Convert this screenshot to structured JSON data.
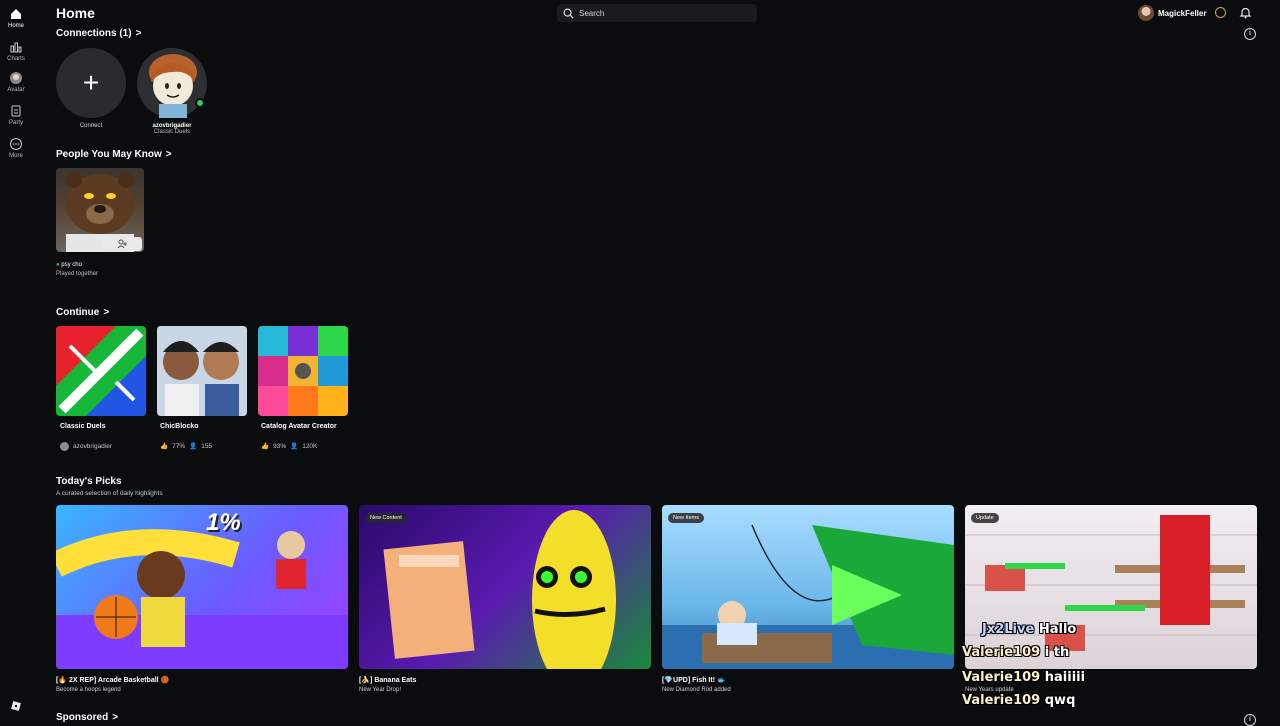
{
  "sidebar": {
    "items": [
      {
        "label": "Home",
        "icon": "home-icon"
      },
      {
        "label": "Charts",
        "icon": "charts-icon"
      },
      {
        "label": "Avatar",
        "icon": "avatar-icon"
      },
      {
        "label": "Party",
        "icon": "party-icon"
      },
      {
        "label": "More",
        "icon": "more-icon"
      }
    ]
  },
  "header": {
    "title": "Home",
    "search_placeholder": "Search",
    "username": "MagickFeller"
  },
  "connections": {
    "title": "Connections (1)",
    "items": [
      {
        "name": "Connect",
        "sub": ""
      },
      {
        "name": "azovbrigadier",
        "sub": "Classic Duels"
      }
    ]
  },
  "people_you_may_know": {
    "title": "People You May Know",
    "items": [
      {
        "name": "psy cho",
        "sub": "Played together"
      }
    ]
  },
  "continue": {
    "title": "Continue",
    "items": [
      {
        "title": "Classic Duels",
        "meta1": "azovbrigadier",
        "meta2": ""
      },
      {
        "title": "ChicBlocko",
        "meta1": "77%",
        "meta2": "155"
      },
      {
        "title": "Catalog Avatar Creator",
        "meta1": "93%",
        "meta2": "120K"
      }
    ]
  },
  "todays_picks": {
    "title": "Today's Picks",
    "subtitle": "A curated selection of daily highlights",
    "items": [
      {
        "title": "[🔥 2X REP] Arcade Basketball 🏀",
        "sub": "Become a hoops legend",
        "badge": "",
        "overlay_text": "1%"
      },
      {
        "title": "[🍌] Banana Eats",
        "sub": "New Year Drop!",
        "badge": "New Content",
        "overlay_text": ""
      },
      {
        "title": "[💎UPD] Fish It! 🐟",
        "sub": "New Diamond Rod added",
        "badge": "New Items",
        "overlay_text": ""
      },
      {
        "title": "",
        "sub": "New Years update",
        "badge": "Update",
        "overlay_text": ""
      }
    ]
  },
  "chat": [
    {
      "name": "Jx2Live",
      "msg": "Hallo"
    },
    {
      "name": "Valerie109",
      "msg": "i th"
    },
    {
      "name": "Valerie109",
      "msg": "haiiiii"
    },
    {
      "name": "Valerie109",
      "msg": "qwq"
    }
  ],
  "sponsored": {
    "title": "Sponsored"
  },
  "colors": {
    "background": "#0b0c0e",
    "online": "#39c464",
    "card": "#2a2b2e"
  }
}
